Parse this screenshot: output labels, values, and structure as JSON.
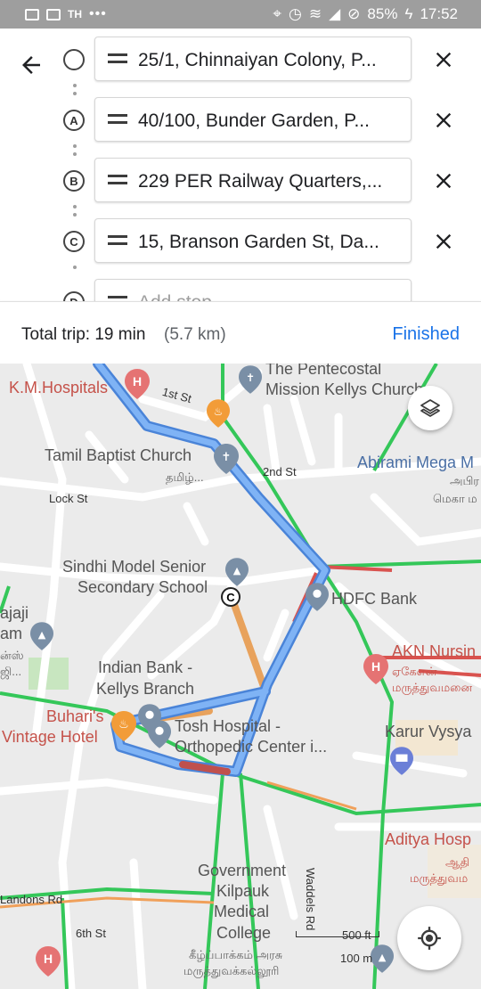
{
  "status_bar": {
    "carrier": "TH",
    "more": "•••",
    "battery": "85%",
    "time": "17:52"
  },
  "directions": {
    "waypoints": [
      {
        "marker": "",
        "address": "25/1, Chinnaiyan Colony, P..."
      },
      {
        "marker": "A",
        "address": "40/100, Bunder Garden, P..."
      },
      {
        "marker": "B",
        "address": "229 PER Railway Quarters,..."
      },
      {
        "marker": "C",
        "address": "15, Branson Garden St, Da..."
      },
      {
        "marker": "D",
        "placeholder": "Add stop"
      }
    ]
  },
  "summary": {
    "total_trip": "Total trip: 19 min",
    "distance": "(5.7 km)",
    "finished_label": "Finished"
  },
  "map": {
    "labels": {
      "km_hospitals": "K.M.Hospitals",
      "first_st": "1st St",
      "pentecostal": "The Pentecostal",
      "mission_kellys": "Mission Kellys Church",
      "tamil_baptist": "Tamil Baptist Church",
      "tamil_short": "தமிழ்...",
      "second_st": "2nd St",
      "abirami": "Abirami Mega M",
      "abirami_tam1": "அபிர",
      "abirami_tam2": "மெகா ம",
      "lock_st": "Lock St",
      "sindhi1": "Sindhi Model Senior",
      "sindhi2": "Secondary School",
      "hdfc": "HDFC Bank",
      "ajaji1": "ajaji",
      "ajaji2": "am",
      "ajaji_tam1": "ன்ஸ்",
      "ajaji_tam2": "ஜி...",
      "akn": "AKN Nursin",
      "akn_tam1": "ஏகேஎன்",
      "akn_tam2": "மருத்துவமனை",
      "indian_bank1": "Indian Bank -",
      "indian_bank2": "Kellys Branch",
      "buharis1": "Buhari's",
      "buharis2": "Vintage Hotel",
      "tosh1": "Tosh Hospital -",
      "tosh2": "Orthopedic Center i...",
      "karur": "Karur Vysya",
      "aditya": "Aditya Hosp",
      "aditya_tam1": "ஆதி",
      "aditya_tam2": "மருத்துவம",
      "waddels": "Waddels Rd",
      "govt1": "Government",
      "govt2": "Kilpauk",
      "govt3": "Medical",
      "govt4": "College",
      "govt_tam1": "கீழ்ப்பாக்கம் அரசு",
      "govt_tam2": "மருத்துவக்கல்லூரி",
      "landons": "Landons Rd",
      "sixth_st": "6th St",
      "scale_ft": "500 ft",
      "scale_m": "100 m",
      "stop_c": "C"
    },
    "colors": {
      "route": "#6ea8ef",
      "route_alt": "#e8a25c",
      "traffic_red": "#d9534f",
      "traffic_green": "#34c759",
      "accent": "#1a73e8"
    }
  },
  "icons": [
    "back-arrow-icon",
    "drag-handle-icon",
    "close-icon",
    "layers-icon",
    "my-location-icon"
  ]
}
